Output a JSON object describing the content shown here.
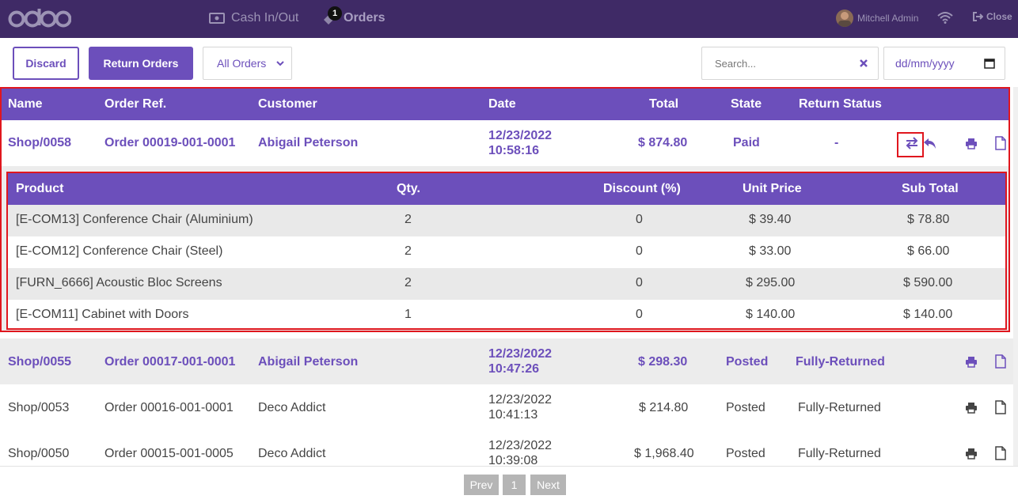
{
  "topbar": {
    "logo": "odoo",
    "cash_label": "Cash In/Out",
    "orders_label": "Orders",
    "orders_badge": "1",
    "user_name": "Mitchell Admin",
    "close_label": "Close"
  },
  "toolbar": {
    "discard_label": "Discard",
    "return_label": "Return Orders",
    "filter_value": "All Orders",
    "search_placeholder": "Search...",
    "date_placeholder": "dd/mm/yyyy"
  },
  "table": {
    "headers": [
      "Name",
      "Order Ref.",
      "Customer",
      "Date",
      "Total",
      "State",
      "Return Status"
    ],
    "rows": [
      {
        "name": "Shop/0058",
        "ref": "Order 00019-001-0001",
        "customer": "Abigail Peterson",
        "date": "12/23/2022",
        "time": "10:58:16",
        "total": "$ 874.80",
        "state": "Paid",
        "return_status": "-"
      },
      {
        "name": "Shop/0055",
        "ref": "Order 00017-001-0001",
        "customer": "Abigail Peterson",
        "date": "12/23/2022",
        "time": "10:47:26",
        "total": "$ 298.30",
        "state": "Posted",
        "return_status": "Fully-Returned"
      },
      {
        "name": "Shop/0053",
        "ref": "Order 00016-001-0001",
        "customer": "Deco Addict",
        "date": "12/23/2022",
        "time": "10:41:13",
        "total": "$ 214.80",
        "state": "Posted",
        "return_status": "Fully-Returned"
      },
      {
        "name": "Shop/0050",
        "ref": "Order 00015-001-0005",
        "customer": "Deco Addict",
        "date": "12/23/2022",
        "time": "10:39:08",
        "total": "$ 1,968.40",
        "state": "Posted",
        "return_status": "Fully-Returned"
      }
    ]
  },
  "lines": {
    "headers": [
      "Product",
      "Qty.",
      "Discount (%)",
      "Unit Price",
      "Sub Total"
    ],
    "rows": [
      {
        "product": "[E-COM13] Conference Chair (Aluminium)",
        "qty": "2",
        "discount": "0",
        "unit": "$ 39.40",
        "sub": "$ 78.80"
      },
      {
        "product": "[E-COM12] Conference Chair (Steel)",
        "qty": "2",
        "discount": "0",
        "unit": "$ 33.00",
        "sub": "$ 66.00"
      },
      {
        "product": "[FURN_6666] Acoustic Bloc Screens",
        "qty": "2",
        "discount": "0",
        "unit": "$ 295.00",
        "sub": "$ 590.00"
      },
      {
        "product": "[E-COM11] Cabinet with Doors",
        "qty": "1",
        "discount": "0",
        "unit": "$ 140.00",
        "sub": "$ 140.00"
      }
    ]
  },
  "pager": {
    "prev": "Prev",
    "page": "1",
    "next": "Next"
  },
  "colors": {
    "brand": "#3f2a66",
    "accent": "#6c4fbb",
    "highlight": "#e0161e"
  }
}
